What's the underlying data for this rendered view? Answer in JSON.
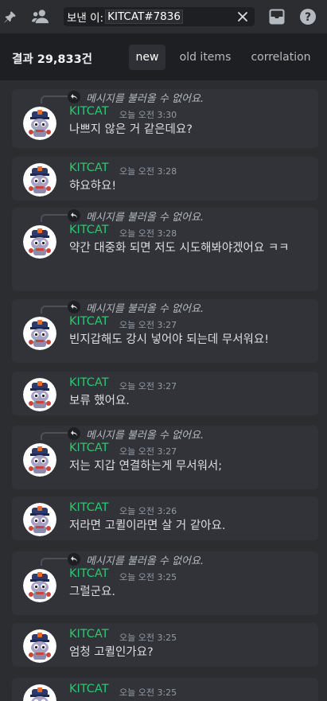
{
  "search": {
    "label": "보낸 이:",
    "value": "KITCAT#7836"
  },
  "results": {
    "count_text": "결과 29,833건",
    "tabs": [
      {
        "label": "new",
        "active": true
      },
      {
        "label": "old items",
        "active": false
      },
      {
        "label": "correlation",
        "active": false
      }
    ]
  },
  "messages": [
    {
      "reply": "메시지를 불러올 수 없어요.",
      "author": "KITCAT",
      "time": "오늘 오전 3:30",
      "content": "나쁘지 않은 거 같은데요?"
    },
    {
      "reply": "",
      "author": "KITCAT",
      "time": "오늘 오전 3:28",
      "content": "햐요햐요!"
    },
    {
      "reply": "메시지를 불러올 수 없어요.",
      "author": "KITCAT",
      "time": "오늘 오전 3:28",
      "content": "약간 대중화 되면 저도 시도해봐야겠어요 ㅋㅋ"
    },
    {
      "reply": "메시지를 불러올 수 없어요.",
      "author": "KITCAT",
      "time": "오늘 오전 3:27",
      "content": "빈지갑해도 강시 넣어야 되는데 무서워요!"
    },
    {
      "reply": "",
      "author": "KITCAT",
      "time": "오늘 오전 3:27",
      "content": "보류 했어요."
    },
    {
      "reply": "메시지를 불러올 수 없어요.",
      "author": "KITCAT",
      "time": "오늘 오전 3:27",
      "content": "저는 지갑 연결하는게 무서워서;"
    },
    {
      "reply": "",
      "author": "KITCAT",
      "time": "오늘 오전 3:26",
      "content": "저라면 고퀼이라면 살 거 같아요."
    },
    {
      "reply": "메시지를 불러올 수 없어요.",
      "author": "KITCAT",
      "time": "오늘 오전 3:25",
      "content": "그럴군요."
    },
    {
      "reply": "",
      "author": "KITCAT",
      "time": "오늘 오전 3:25",
      "content": "엄청 고퀼인가요?"
    },
    {
      "reply": "",
      "author": "KITCAT",
      "time": "오늘 오전 3:25",
      "content": ""
    }
  ],
  "colors": {
    "author": "#2dc770",
    "background": "#2b2d31",
    "card": "#313338"
  },
  "icons": [
    "pin-icon",
    "members-icon",
    "clear-search-icon",
    "inbox-icon",
    "help-icon",
    "reply-arrow-icon"
  ]
}
